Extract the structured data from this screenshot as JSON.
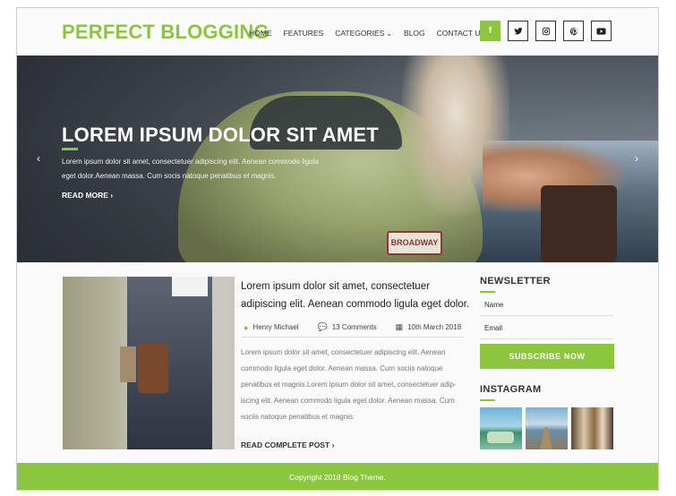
{
  "header": {
    "logo": "PERFECT BLOGGING",
    "nav": [
      "HOME",
      "FEATURES",
      "CATEGORIES",
      "BLOG",
      "CONTACT US"
    ],
    "nav_dropdown_icon": "chevron-down-icon",
    "social": [
      {
        "icon": "facebook-icon",
        "glyph": "f"
      },
      {
        "icon": "twitter-icon",
        "glyph": "🐦"
      },
      {
        "icon": "instagram-icon",
        "glyph": "◎"
      },
      {
        "icon": "pinterest-icon",
        "glyph": "𝓅"
      },
      {
        "icon": "youtube-icon",
        "glyph": "▶"
      }
    ]
  },
  "hero": {
    "title": "LOREM IPSUM DOLOR SIT AMET",
    "text": "Lorem ipsum dolor sit amet, consectetuer adipiscing elit. Aenean commodo ligula eget dolor.Aenean massa. Cum socis natoque penatibus et magnis.",
    "read_more": "READ MORE",
    "plate": "BROADWAY"
  },
  "post": {
    "title": "Lorem ipsum dolor sit amet, consectetuer adipiscing elit. Aenean commodo ligula eget dolor.",
    "author": "Henry Michael",
    "comments": "13 Comments",
    "date": "10th March 2018",
    "body": "Lorem ipsum dolor sit amet, consectetuer adipiscing elit. Aenean commodo ligula eget dolor. Aenean massa. Cum sociis natoque penatibus et magnis.Lorem ipsum dolor sit amet, consectetuer adip-iscing elit. Aenean commodo ligula eget dolor. Aenean massa. Cum sociis natoque penatibus et magnis.",
    "read_complete": "READ COMPLETE POST"
  },
  "sidebar": {
    "newsletter_title": "NEWSLETTER",
    "name_placeholder": "Name",
    "email_placeholder": "Email",
    "subscribe": "SUBSCRIBE NOW",
    "instagram_title": "INSTAGRAM"
  },
  "footer": {
    "copyright": "Copyright 2018 Blog Theme."
  },
  "colors": {
    "accent": "#8cc63f",
    "text_dark": "#333333",
    "text_muted": "#777777"
  }
}
